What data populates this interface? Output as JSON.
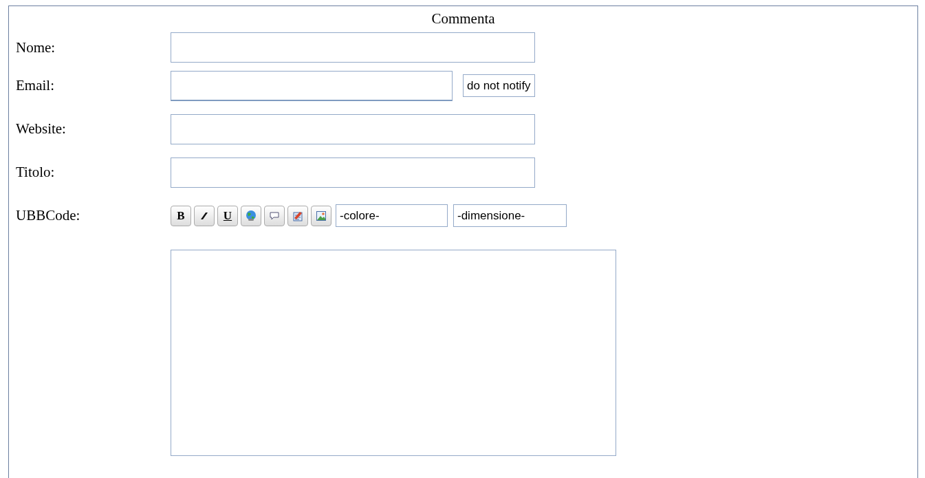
{
  "form": {
    "title": "Commenta",
    "fields": [
      {
        "label": "Nome:",
        "kind": "text"
      },
      {
        "label": "Email:",
        "kind": "email",
        "option": "do not notify"
      },
      {
        "label": "Website:",
        "kind": "text"
      },
      {
        "label": "Titolo:",
        "kind": "text"
      }
    ],
    "ubbcode": {
      "label": "UBBCode:",
      "tools": [
        {
          "kind": "bold",
          "label": "B"
        },
        {
          "kind": "italic"
        },
        {
          "kind": "underline",
          "label": "U"
        },
        {
          "kind": "globe"
        },
        {
          "kind": "bubble"
        },
        {
          "kind": "notepad"
        },
        {
          "kind": "image"
        }
      ],
      "selects": [
        "-colore-",
        "-dimensione-"
      ]
    }
  }
}
